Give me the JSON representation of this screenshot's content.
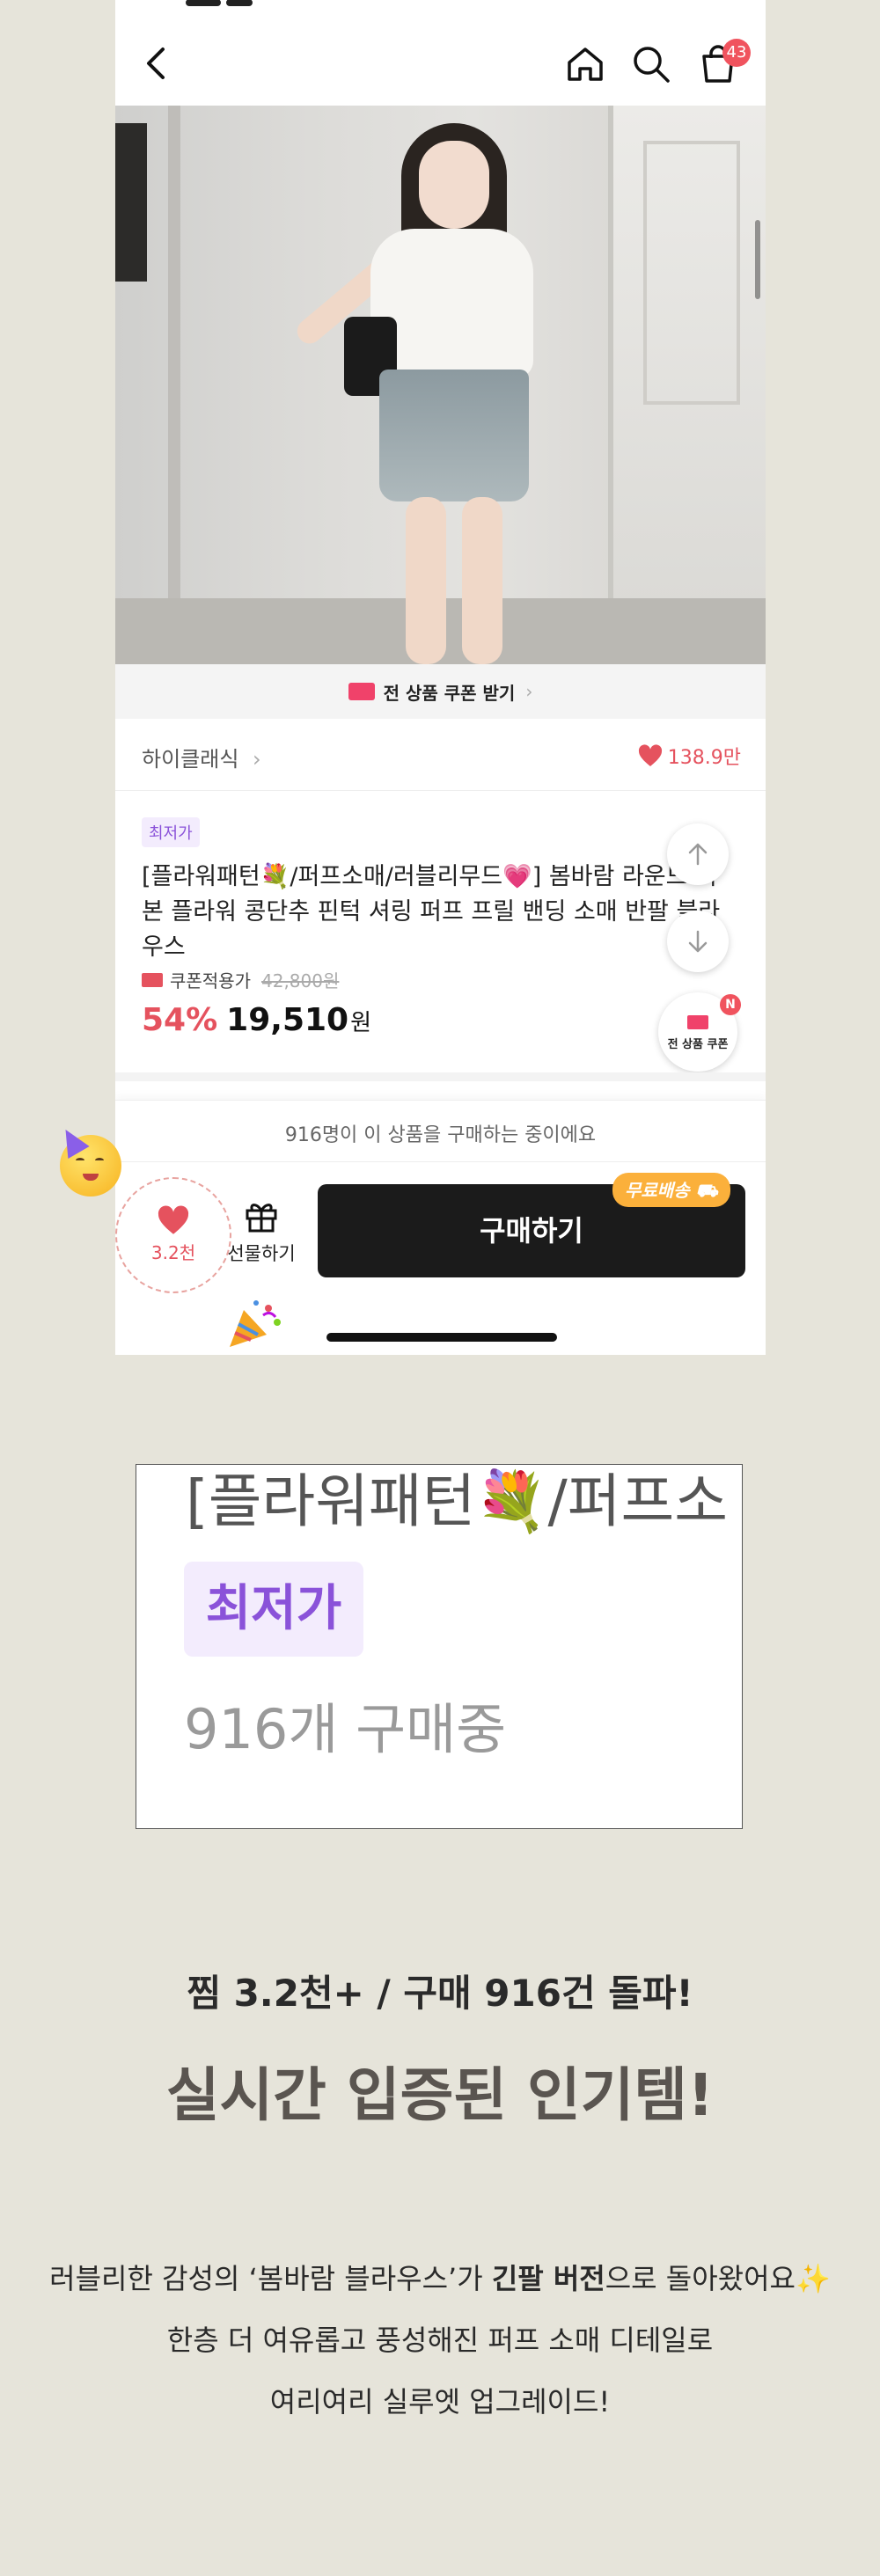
{
  "header": {
    "cart_count": "43"
  },
  "hero": {
    "slide_count": 5,
    "active_slide": 1
  },
  "coupon_strip": {
    "label": "전 상품 쿠폰 받기",
    "chevron": "›"
  },
  "brand": {
    "name": "하이클래식",
    "chevron": "›",
    "likes": "138.9만"
  },
  "product": {
    "badge": "최저가",
    "title": "[플라워패턴💐/퍼프소매/러블리무드💗] 봄바람 라운드 리본 플라워 콩단추 핀턱 셔링 퍼프 프릴 밴딩 소매 반팔 블라우스",
    "coupon_label": "쿠폰적용가",
    "original_price": "42,800원",
    "discount": "54%",
    "price": "19,510",
    "currency": "원"
  },
  "floating": {
    "coupon_label": "전 상품 쿠폰",
    "coupon_badge": "N"
  },
  "bottom_bar": {
    "buying_now": "916명이 이 상품을 구매하는 중이에요",
    "like_count": "3.2천",
    "gift_label": "선물하기",
    "buy_label": "구매하기",
    "free_shipping": "무료배송"
  },
  "zoom": {
    "title": "[플라워패턴💐/퍼프소",
    "badge": "최저가",
    "count": "916개 구매중"
  },
  "promo": {
    "headline1": "찜 3.2천+ / 구매 916건 돌파!",
    "headline2": "실시간 입증된 인기템!",
    "line1_pre": "러블리한 감성의 ‘봄바람 블라우스’가 ",
    "line1_bold": "긴팔 버전",
    "line1_post": "으로 돌아왔어요✨",
    "line2": "한층 더 여유롭고 풍성해진 퍼프 소매 디테일로",
    "line3": "여리여리 실루엣 업그레이드!"
  },
  "colors": {
    "accent_red": "#e5525e",
    "badge_purple": "#8a52d9",
    "buy_button": "#1b1b1b",
    "free_shipping": "#fbb03b"
  }
}
